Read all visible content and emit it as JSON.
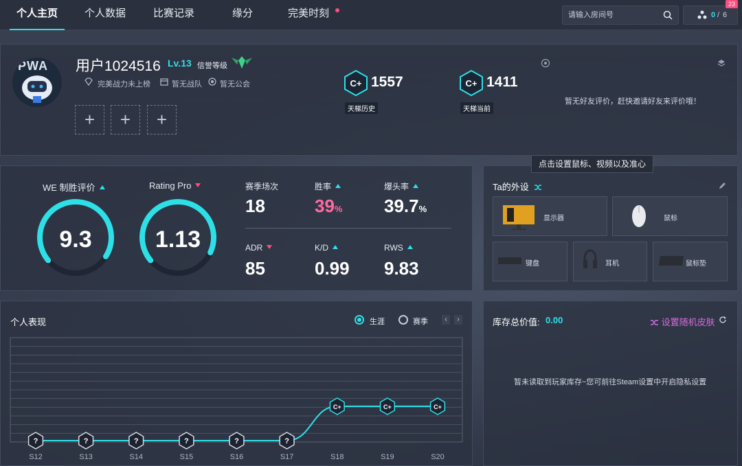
{
  "nav": {
    "tabs": [
      {
        "label": "个人主页"
      },
      {
        "label": "个人数据"
      },
      {
        "label": "比赛记录"
      },
      {
        "label": "缘分"
      },
      {
        "label": "完美时刻"
      }
    ],
    "search_placeholder": "请输入房间号",
    "counter_current": "0",
    "counter_sep": "/",
    "counter_total": "6",
    "notif_badge": "23"
  },
  "profile": {
    "avatar_text": "PWA",
    "username": "用户1024516",
    "level": "Lv.13",
    "credit_label": "信誉等级",
    "meta": [
      "完美战力未上榜",
      "暂无战队",
      "暂无公会"
    ],
    "slot_symbol": "+",
    "rank_badge_text": "C+",
    "ladder_history_value": "1557",
    "ladder_history_label": "天梯历史",
    "ladder_current_value": "1411",
    "ladder_current_label": "天梯当前",
    "friend_review": "暂无好友评价，赶快邀请好友来评价哦！"
  },
  "ratings": {
    "we_title": "WE 制胜评价",
    "we_value": "9.3",
    "we_fraction": 0.7,
    "rp_title": "Rating Pro",
    "rp_value": "1.13",
    "rp_fraction": 0.68,
    "stats": [
      {
        "label": "赛季场次",
        "value": "18",
        "suffix": "",
        "trend": "none",
        "color": "#ffffff"
      },
      {
        "label": "胜率",
        "value": "39",
        "suffix": "%",
        "trend": "up",
        "color": "#ff6aa0"
      },
      {
        "label": "爆头率",
        "value": "39.7",
        "suffix": "%",
        "trend": "up",
        "color": "#ffffff"
      },
      {
        "label": "ADR",
        "value": "85",
        "suffix": "",
        "trend": "down",
        "color": "#ffffff"
      },
      {
        "label": "K/D",
        "value": "0.99",
        "suffix": "",
        "trend": "up",
        "color": "#ffffff"
      },
      {
        "label": "RWS",
        "value": "9.83",
        "suffix": "",
        "trend": "up",
        "color": "#ffffff"
      }
    ]
  },
  "gear": {
    "title": "Ta的外设",
    "tooltip": "点击设置鼠标、视频以及准心",
    "items": {
      "monitor": "显示器",
      "mouse": "鼠标",
      "keyboard": "键盘",
      "headset": "耳机",
      "mousepad": "鼠标垫"
    }
  },
  "performance": {
    "title": "个人表现",
    "radio_career": "生涯",
    "radio_season": "赛季",
    "selected": "career",
    "prev": "‹",
    "next": "›"
  },
  "inventory": {
    "title": "库存总价值:",
    "value": "0.00",
    "random_skin": "设置随机皮肤",
    "empty_text": "暂未读取到玩家库存~您可前往Steam设置中开启隐私设置"
  },
  "chart_data": {
    "type": "line",
    "title": "",
    "categories": [
      "S12",
      "S13",
      "S14",
      "S15",
      "S16",
      "S17",
      "S18",
      "S19",
      "S20"
    ],
    "series": [
      {
        "values": [
          0,
          0,
          0,
          0,
          0,
          0,
          1,
          1,
          1
        ],
        "markers": [
          "?",
          "?",
          "?",
          "?",
          "?",
          "?",
          "C+",
          "C+",
          "C+"
        ]
      }
    ],
    "grid": true,
    "line_color": "#2de0e8"
  },
  "colors": {
    "accent": "#2de0e8",
    "pink": "#ff4d7e",
    "purple": "#d66be0"
  }
}
